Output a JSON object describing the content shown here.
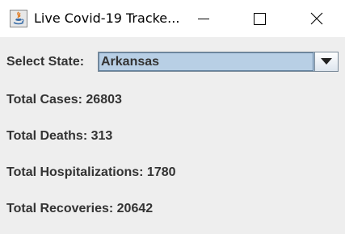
{
  "window": {
    "title": "Live Covid-19 Tracke...",
    "app_icon": "java-icon",
    "controls": {
      "minimize_icon": "minimize-icon",
      "maximize_icon": "maximize-icon",
      "close_icon": "close-icon"
    }
  },
  "form": {
    "select_label": "Select State:",
    "selected_state": "Arkansas",
    "dropdown_icon": "triangle-down-icon"
  },
  "stats": {
    "cases": "Total Cases: 26803",
    "deaths": "Total Deaths: 313",
    "hospitalizations": "Total Hospitalizations: 1780",
    "recoveries": "Total Recoveries: 20642"
  },
  "colors": {
    "content_bg": "#eeeeee",
    "combo_bg": "#b8cfe5",
    "text": "#333333"
  }
}
